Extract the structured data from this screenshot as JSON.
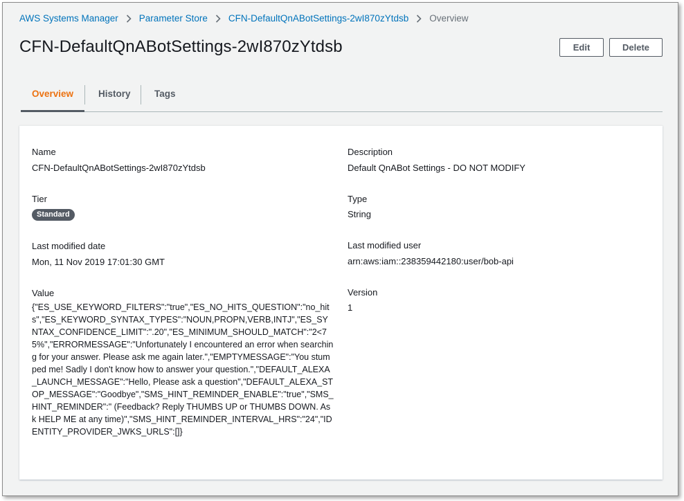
{
  "breadcrumb": {
    "items": [
      "AWS Systems Manager",
      "Parameter Store",
      "CFN-DefaultQnABotSettings-2wI870zYtdsb"
    ],
    "current": "Overview"
  },
  "page": {
    "title": "CFN-DefaultQnABotSettings-2wI870zYtdsb"
  },
  "actions": {
    "edit_label": "Edit",
    "delete_label": "Delete"
  },
  "tabs": [
    {
      "label": "Overview",
      "active": true
    },
    {
      "label": "History",
      "active": false
    },
    {
      "label": "Tags",
      "active": false
    }
  ],
  "details": {
    "name_label": "Name",
    "name_value": "CFN-DefaultQnABotSettings-2wI870zYtdsb",
    "description_label": "Description",
    "description_value": "Default QnABot Settings - DO NOT MODIFY",
    "tier_label": "Tier",
    "tier_value": "Standard",
    "type_label": "Type",
    "type_value": "String",
    "last_modified_date_label": "Last modified date",
    "last_modified_date_value": "Mon, 11 Nov 2019 17:01:30 GMT",
    "last_modified_user_label": "Last modified user",
    "last_modified_user_value": "arn:aws:iam::238359442180:user/bob-api",
    "value_label": "Value",
    "value_text": "{\"ES_USE_KEYWORD_FILTERS\":\"true\",\"ES_NO_HITS_QUESTION\":\"no_hits\",\"ES_KEYWORD_SYNTAX_TYPES\":\"NOUN,PROPN,VERB,INTJ\",\"ES_SYNTAX_CONFIDENCE_LIMIT\":\".20\",\"ES_MINIMUM_SHOULD_MATCH\":\"2<75%\",\"ERRORMESSAGE\":\"Unfortunately I encountered an error when searching for your answer. Please ask me again later.\",\"EMPTYMESSAGE\":\"You stumped me! Sadly I don't know how to answer your question.\",\"DEFAULT_ALEXA_LAUNCH_MESSAGE\":\"Hello, Please ask a question\",\"DEFAULT_ALEXA_STOP_MESSAGE\":\"Goodbye\",\"SMS_HINT_REMINDER_ENABLE\":\"true\",\"SMS_HINT_REMINDER\":\" (Feedback? Reply THUMBS UP or THUMBS DOWN. Ask HELP ME at any time)\",\"SMS_HINT_REMINDER_INTERVAL_HRS\":\"24\",\"IDENTITY_PROVIDER_JWKS_URLS\":[]}",
    "version_label": "Version",
    "version_value": "1"
  },
  "icons": {
    "separator": "chevron-right-icon"
  },
  "colors": {
    "link": "#0073bb",
    "active_tab": "#ec7211",
    "badge": "#545b64"
  }
}
